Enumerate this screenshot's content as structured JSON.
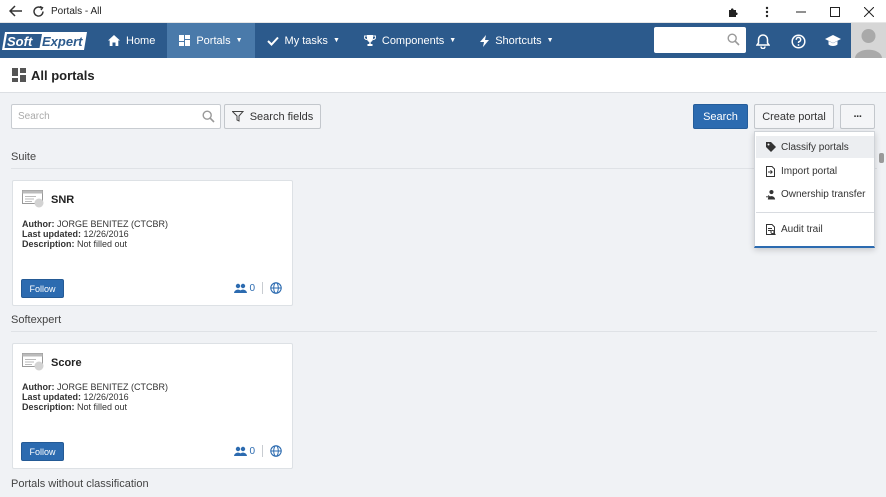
{
  "window": {
    "title": "Portals - All"
  },
  "nav": {
    "logo_text": "SoftExpert",
    "items": [
      {
        "label": "Home",
        "icon": "home-icon",
        "dropdown": false
      },
      {
        "label": "Portals",
        "icon": "portals-icon",
        "dropdown": true,
        "active": true
      },
      {
        "label": "My tasks",
        "icon": "check-icon",
        "dropdown": true
      },
      {
        "label": "Components",
        "icon": "trophy-icon",
        "dropdown": true
      },
      {
        "label": "Shortcuts",
        "icon": "bolt-icon",
        "dropdown": true
      }
    ],
    "search_placeholder": ""
  },
  "page": {
    "title": "All portals"
  },
  "toolbar": {
    "search_placeholder": "Search",
    "search_fields_label": "Search fields",
    "search_button": "Search",
    "create_portal_button": "Create portal",
    "more_button": "···"
  },
  "menu": {
    "items": [
      {
        "label": "Classify portals",
        "icon": "tag-icon"
      },
      {
        "label": "Import portal",
        "icon": "import-icon"
      },
      {
        "label": "Ownership transfer",
        "icon": "user-transfer-icon"
      },
      {
        "label": "Audit trail",
        "icon": "audit-icon"
      }
    ]
  },
  "sections": [
    {
      "label": "Suite",
      "card": {
        "title": "SNR",
        "author_label": "Author:",
        "author": "JORGE BENITEZ (CTCBR)",
        "updated_label": "Last updated:",
        "updated": "12/26/2016",
        "description_label": "Description:",
        "description": "Not filled out",
        "follow_label": "Follow",
        "followers": "0"
      }
    },
    {
      "label": "Softexpert",
      "card": {
        "title": "Score",
        "author_label": "Author:",
        "author": "JORGE BENITEZ (CTCBR)",
        "updated_label": "Last updated:",
        "updated": "12/26/2016",
        "description_label": "Description:",
        "description": "Not filled out",
        "follow_label": "Follow",
        "followers": "0"
      }
    },
    {
      "label": "Portals without classification"
    }
  ],
  "colors": {
    "nav_bg": "#2c5a8c",
    "nav_active": "#4a7aaa",
    "primary": "#2c6bb0",
    "content_bg": "#f0f2f5"
  }
}
